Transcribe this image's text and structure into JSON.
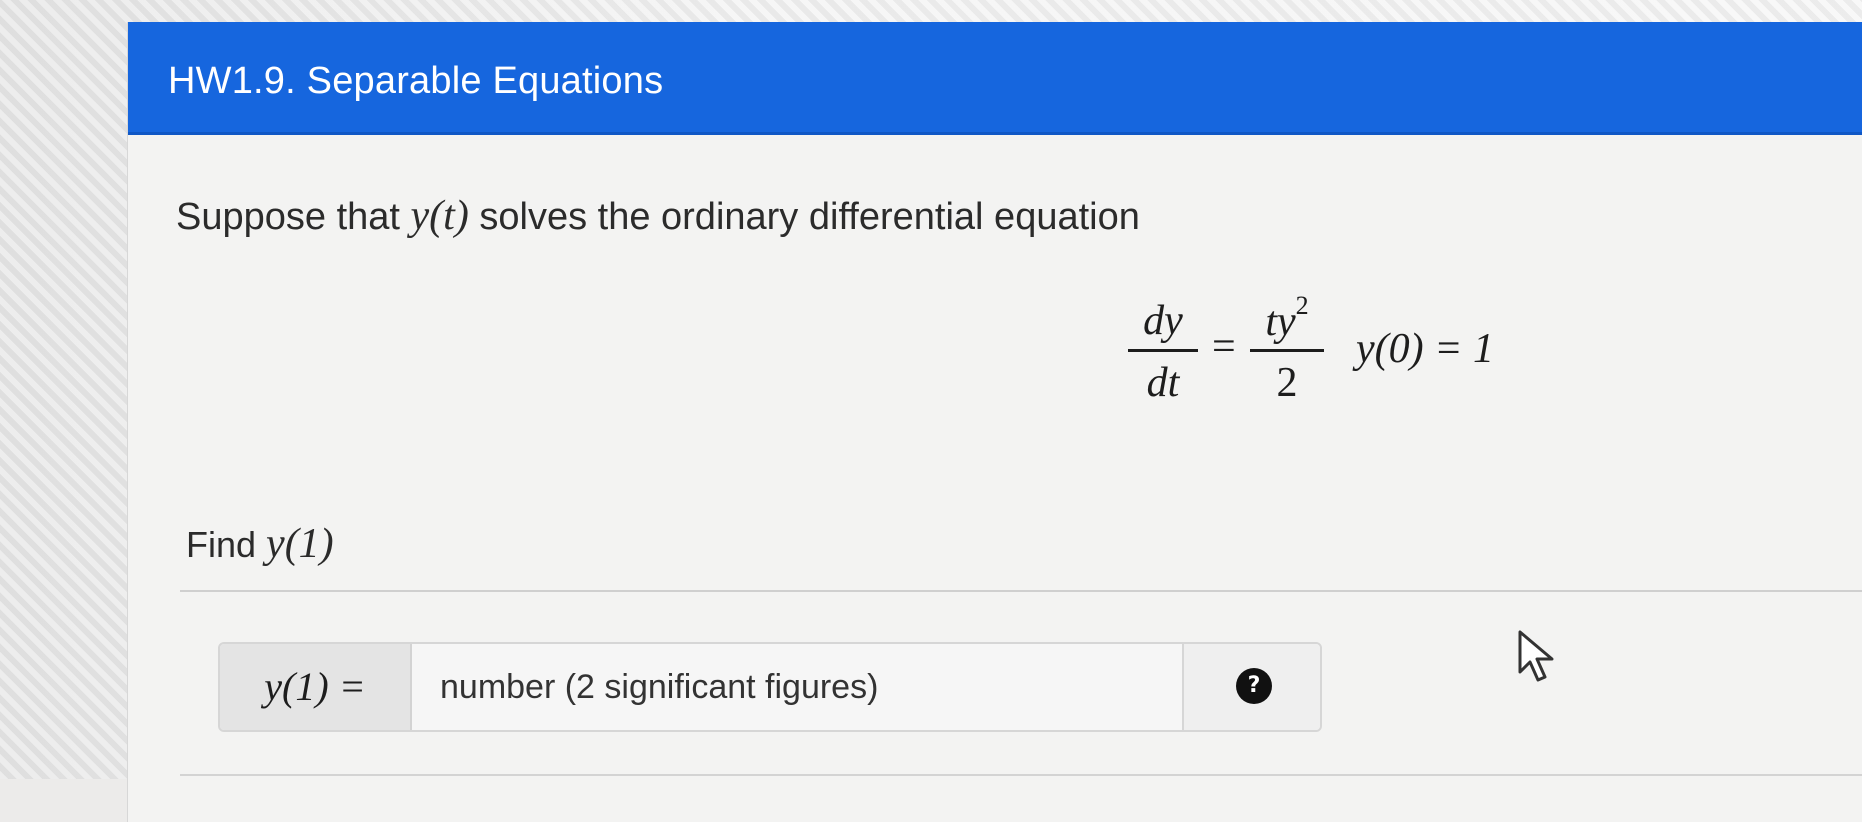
{
  "card": {
    "title": "HW1.9. Separable Equations"
  },
  "question": {
    "intro_prefix": "Suppose that ",
    "intro_var": "y(t)",
    "intro_suffix": " solves the ordinary differential equation",
    "equation": {
      "lhs_num": "dy",
      "lhs_den": "dt",
      "equals": "=",
      "rhs_num": "ty",
      "rhs_exp": "2",
      "rhs_den": "2",
      "condition": "y(0) = 1"
    },
    "find_prefix": "Find ",
    "find_var": "y(1)"
  },
  "answer": {
    "label": "y(1) =",
    "placeholder": "number (2 significant figures)",
    "value": "",
    "help_glyph": "?"
  },
  "colors": {
    "header_bg": "#1666de",
    "header_text": "#ffffff",
    "help_icon_bg": "#111111"
  }
}
